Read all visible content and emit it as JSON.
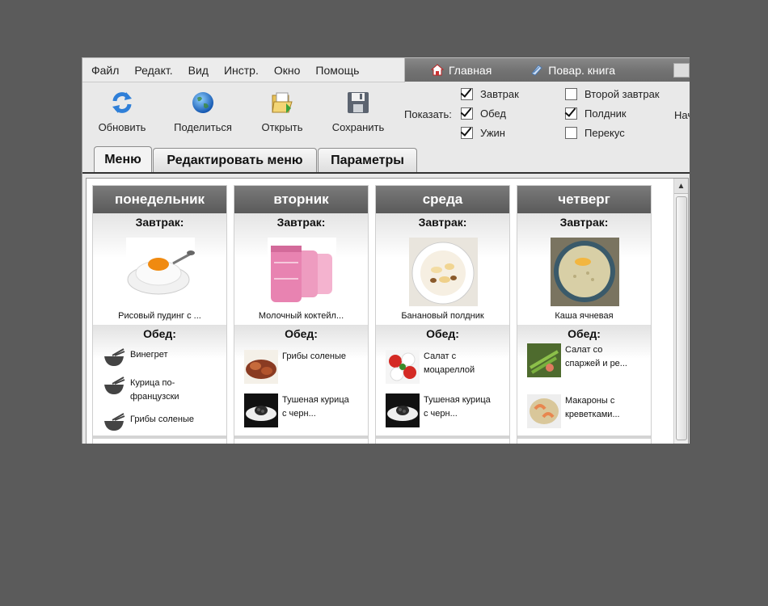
{
  "menubar": {
    "items": [
      "Файл",
      "Редакт.",
      "Вид",
      "Инстр.",
      "Окно",
      "Помощь"
    ]
  },
  "nav": {
    "home": "Главная",
    "cookbook": "Повар. книга"
  },
  "toolbar": {
    "refresh": "Обновить",
    "share": "Поделиться",
    "open": "Открыть",
    "save": "Сохранить",
    "show_label": "Показать:",
    "cut_text": "Нач"
  },
  "filters": [
    {
      "label": "Завтрак",
      "checked": true
    },
    {
      "label": "Обед",
      "checked": true
    },
    {
      "label": "Ужин",
      "checked": true
    },
    {
      "label": "Второй завтрак",
      "checked": false
    },
    {
      "label": "Полдник",
      "checked": true
    },
    {
      "label": "Перекус",
      "checked": false
    }
  ],
  "tabs": [
    "Меню",
    "Редактировать меню",
    "Параметры"
  ],
  "days": [
    {
      "name": "понедельник",
      "breakfast_title": "Завтрак:",
      "breakfast": "Рисовый пудинг с ...",
      "lunch_title": "Обед:",
      "lunch": [
        "Винегрет",
        "Курица по-французски",
        "Грибы соленые"
      ]
    },
    {
      "name": "вторник",
      "breakfast_title": "Завтрак:",
      "breakfast": "Молочный коктейл...",
      "lunch_title": "Обед:",
      "lunch": [
        "Грибы соленые",
        "Тушеная курица с черн..."
      ]
    },
    {
      "name": "среда",
      "breakfast_title": "Завтрак:",
      "breakfast": "Банановый полдник",
      "lunch_title": "Обед:",
      "lunch": [
        "Салат с моцареллой",
        "Тушеная курица с черн..."
      ]
    },
    {
      "name": "четверг",
      "breakfast_title": "Завтрак:",
      "breakfast": "Каша ячневая",
      "lunch_title": "Обед:",
      "lunch": [
        "Салат со спаржей и ре...",
        "Макароны с креветками..."
      ]
    }
  ],
  "colors": {
    "background": "#5b5b5b",
    "day_header": "#666666",
    "nav_strip": "#777777"
  }
}
